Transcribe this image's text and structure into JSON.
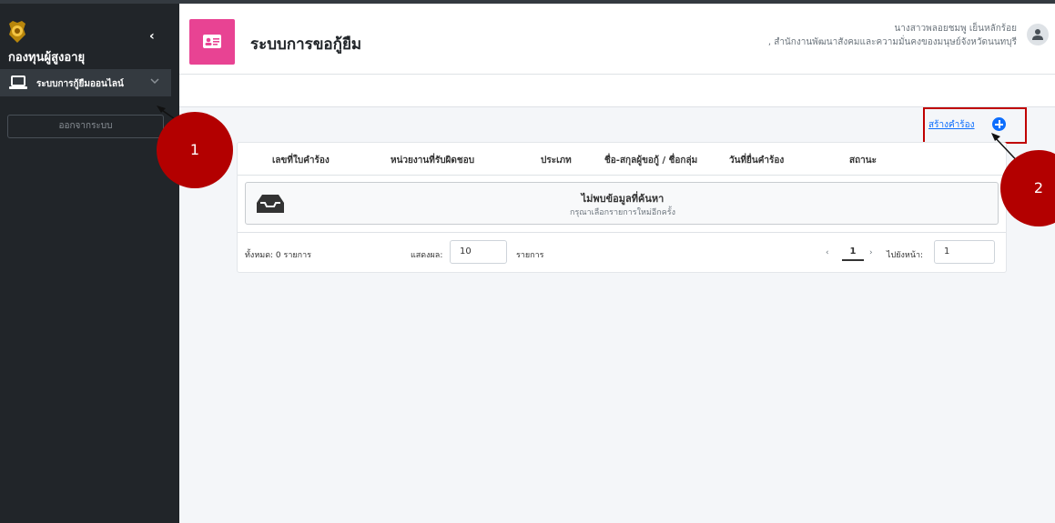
{
  "sidebar": {
    "brand": "กองทุนผู้สูงอายุ",
    "collapse_glyph": "‹",
    "nav_item_label": "ระบบการกู้ยืมออนไลน์",
    "logout_label": "ออกจากระบบ"
  },
  "header": {
    "title": "ระบบการขอกู้ยืม",
    "user_name": "นางสาวพลอยชมพู เย็นหลักร้อย",
    "user_org": ", สำนักงานพัฒนาสังคมและความมั่นคงของมนุษย์จังหวัดนนทบุรี"
  },
  "actions": {
    "create_label": "สร้างคำร้อง"
  },
  "table": {
    "headers": [
      "เลขที่ใบคำร้อง",
      "หน่วยงานที่รับผิดชอบ",
      "ประเภท",
      "ชื่อ-สกุลผู้ขอกู้ / ชื่อกลุ่ม",
      "วันที่ยื่นคำร้อง",
      "สถานะ"
    ],
    "empty_title": "ไม่พบข้อมูลที่ค้นหา",
    "empty_subtitle": "กรุณาเลือกรายการใหม่อีกครั้ง"
  },
  "footer": {
    "total": "ทั้งหมด: 0 รายการ",
    "show_label": "แสดงผล:",
    "show_value": "10",
    "show_unit": "รายการ",
    "prev": "‹",
    "page": "1",
    "next": "›",
    "goto_label": "ไปยังหน้า:",
    "goto_value": "1"
  },
  "annotations": {
    "marker_1": "1",
    "marker_2": "2"
  },
  "colors": {
    "sidebar_bg": "#212529",
    "header_icon_bg": "#e84393",
    "link": "#0d6efd",
    "highlight": "#c00000",
    "marker": "#b30000"
  }
}
